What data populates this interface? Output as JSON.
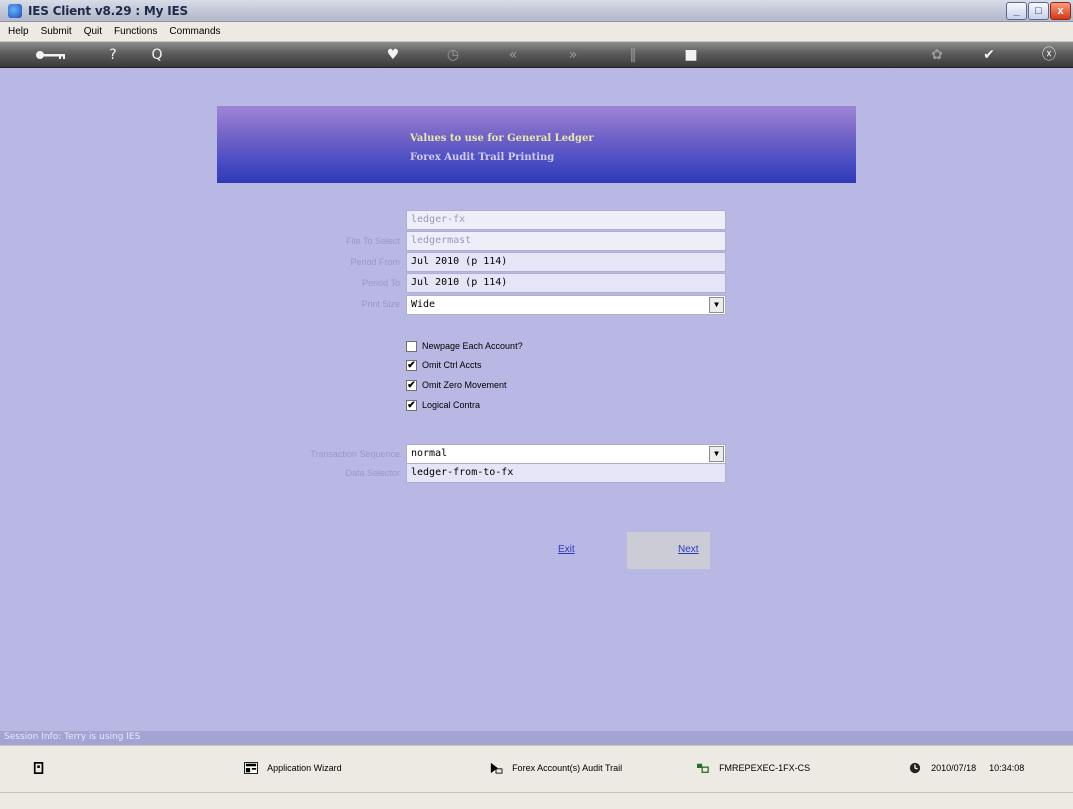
{
  "window": {
    "title": "IES Client v8.29 : My IES",
    "controls": {
      "minimize": "_",
      "maximize": "□",
      "close": "x"
    }
  },
  "menu": [
    "Help",
    "Submit",
    "Quit",
    "Functions",
    "Commands"
  ],
  "toolbar": {
    "icons": [
      "key-icon",
      "help-icon",
      "search-icon",
      "heart-icon",
      "clock-icon",
      "rewind-icon",
      "forward-icon",
      "pause-icon",
      "stop-icon",
      "settings-icon",
      "ok-icon",
      "close-icon"
    ],
    "glyphs": {
      "help": "?",
      "search": "Q",
      "heart": "♥",
      "clock": "◷",
      "rewind": "«",
      "forward": "»",
      "pause": "‖",
      "stop": "■",
      "settings": "✿",
      "ok": "✔",
      "close": "ⓧ"
    }
  },
  "banner": {
    "line1": "Values to use for General Ledger",
    "line2": "Forex Audit Trail Printing"
  },
  "form": {
    "top_field": "ledger-fx",
    "file_to_select": {
      "label": "File To Select",
      "value": "ledgermast"
    },
    "period_from": {
      "label": "Period From",
      "value": "Jul 2010 (p 114)"
    },
    "period_to": {
      "label": "Period To",
      "value": "Jul 2010 (p 114)"
    },
    "print_size": {
      "label": "Print Size",
      "value": "Wide"
    },
    "checkboxes": [
      {
        "label": "Newpage Each Account?",
        "checked": false
      },
      {
        "label": "Omit Ctrl Accts",
        "checked": true
      },
      {
        "label": "Omit Zero Movement",
        "checked": true
      },
      {
        "label": "Logical Contra",
        "checked": true
      }
    ],
    "check_mark": "✔",
    "transaction_sequence": {
      "label": "Transaction Sequence",
      "value": "normal"
    },
    "data_selector": {
      "label": "Data Selector",
      "value": "ledger-from-to-fx"
    },
    "combo_arrow": "▼"
  },
  "actions": {
    "exit": "Exit",
    "next": "Next"
  },
  "session": "Session Info: Terry is using IES",
  "status": {
    "app_wizard": "Application Wizard",
    "report": "Forex Account(s) Audit Trail",
    "program": "FMREPEXEC-1FX-CS",
    "date": "2010/07/18",
    "time": "10:34:08"
  },
  "colors": {
    "background": "#b9b7e3",
    "banner_top": "#9e86d6",
    "banner_bottom": "#2f3ab8",
    "link": "#2a3ac0"
  }
}
